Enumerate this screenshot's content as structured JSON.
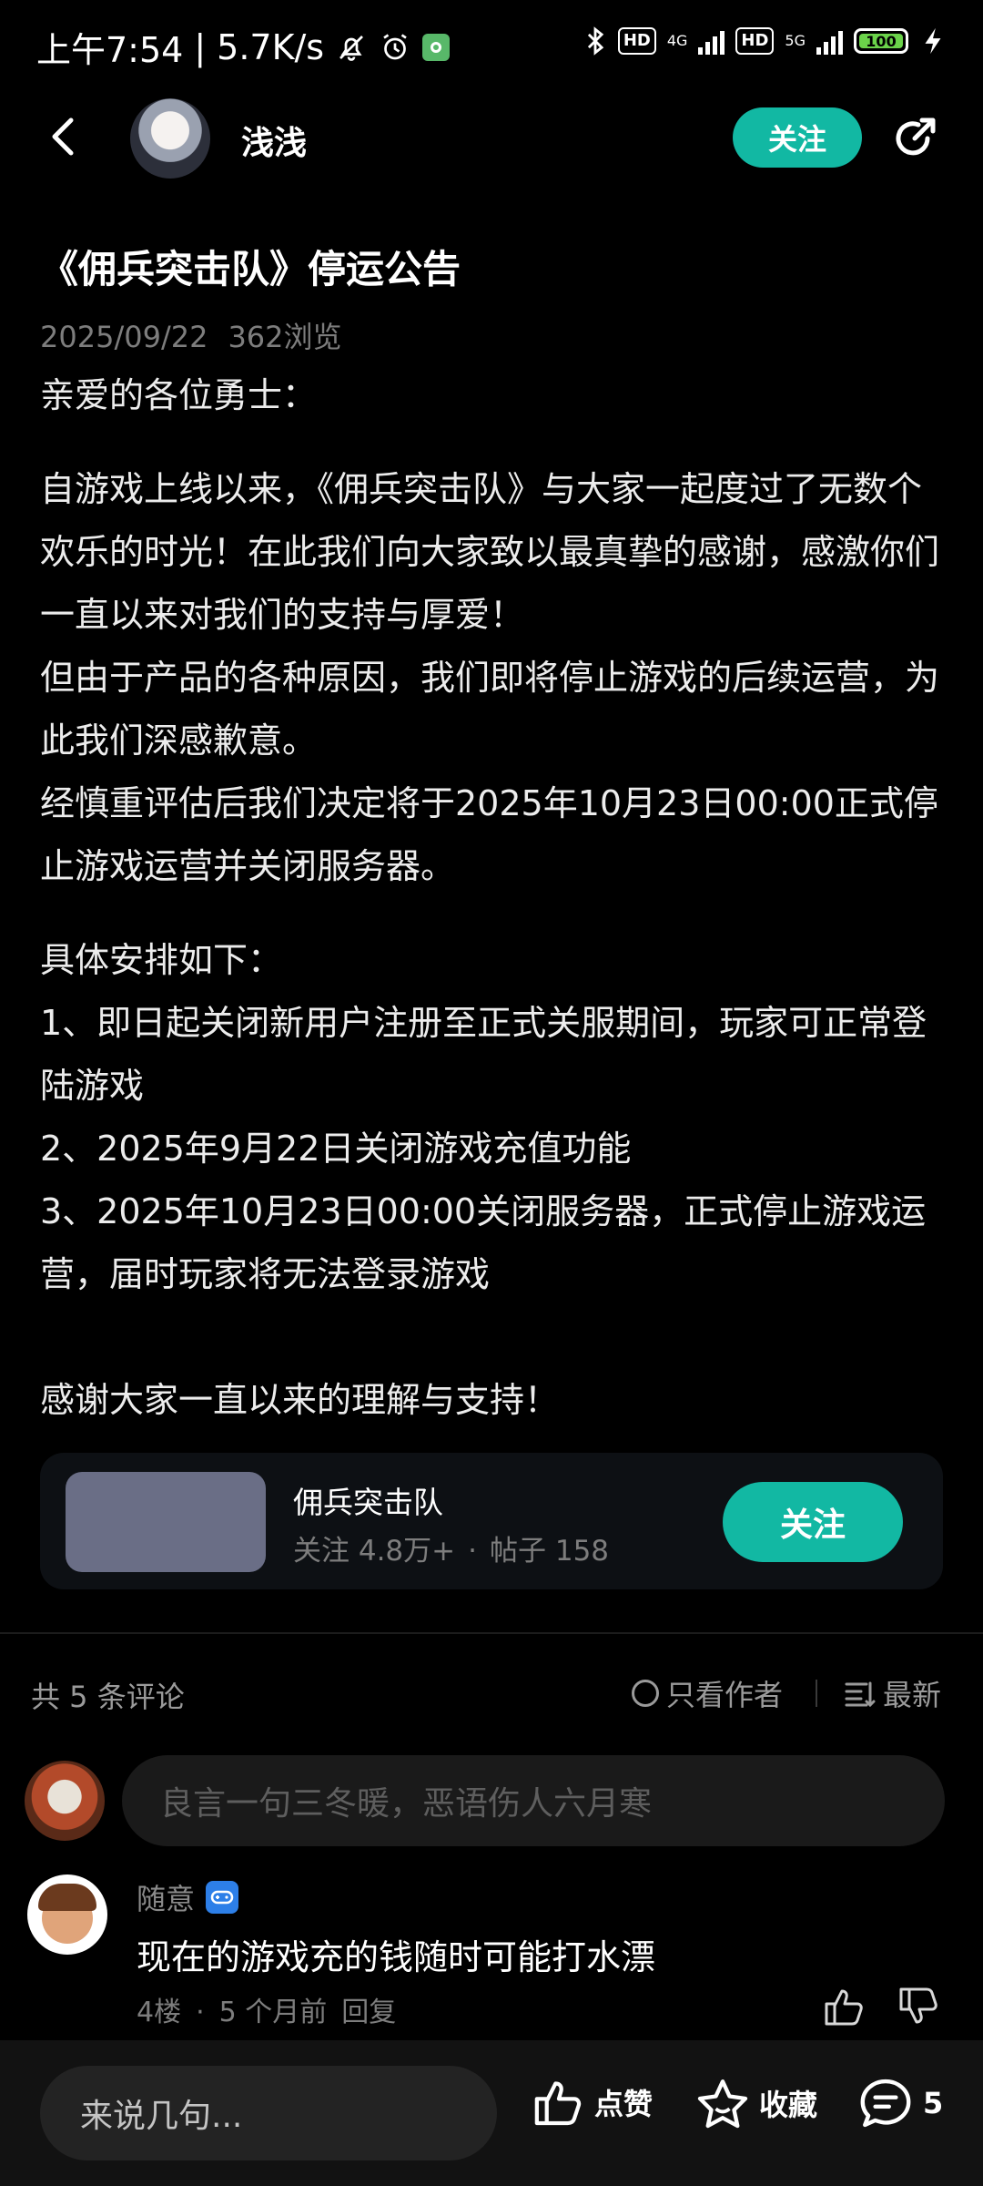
{
  "status_bar": {
    "time": "上午7:54",
    "speed": "5.7K/s",
    "hd1": "HD",
    "net1": "4G",
    "hd2": "HD",
    "net2": "5G",
    "battery": "100"
  },
  "header": {
    "author": "浅浅",
    "follow_label": "关注"
  },
  "article": {
    "title": "《佣兵突击队》停运公告",
    "date": "2025/09/22",
    "views": "362浏览",
    "greeting": "亲爱的各位勇士：",
    "para1": "自游戏上线以来，《佣兵突击队》与大家一起度过了无数个欢乐的时光！在此我们向大家致以最真挚的感谢，感激你们一直以来对我们的支持与厚爱！",
    "para2": "但由于产品的各种原因，我们即将停止游戏的后续运营，为此我们深感歉意。",
    "para3": "经慎重评估后我们决定将于2025年10月23日00:00正式停止游戏运营并关闭服务器。",
    "arrange_title": "具体安排如下：",
    "item1": "1、即日起关闭新用户注册至正式关服期间，玩家可正常登陆游戏",
    "item2": "2、2025年9月22日关闭游戏充值功能",
    "item3": "3、2025年10月23日00:00关闭服务器，正式停止游戏运营，届时玩家将无法登录游戏",
    "closing": "感谢大家一直以来的理解与支持！"
  },
  "game_card": {
    "name": "佣兵突击队",
    "followers": "关注 4.8万+",
    "dot": "·",
    "posts": "帖子 158",
    "follow_label": "关注"
  },
  "comments": {
    "count_label": "共 5 条评论",
    "author_only": "只看作者",
    "sort": "最新",
    "input_placeholder": "良言一句三冬暖，恶语伤人六月寒",
    "items": [
      {
        "user": "随意",
        "text": "现在的游戏充的钱随时可能打水漂",
        "floor": "4楼",
        "dot": "·",
        "time": "5 个月前",
        "reply": "回复"
      }
    ]
  },
  "bottom_bar": {
    "placeholder": "来说几句...",
    "like": "点赞",
    "favorite": "收藏",
    "comment_count": "5"
  },
  "colors": {
    "accent": "#12b8a3",
    "background": "#000000"
  }
}
